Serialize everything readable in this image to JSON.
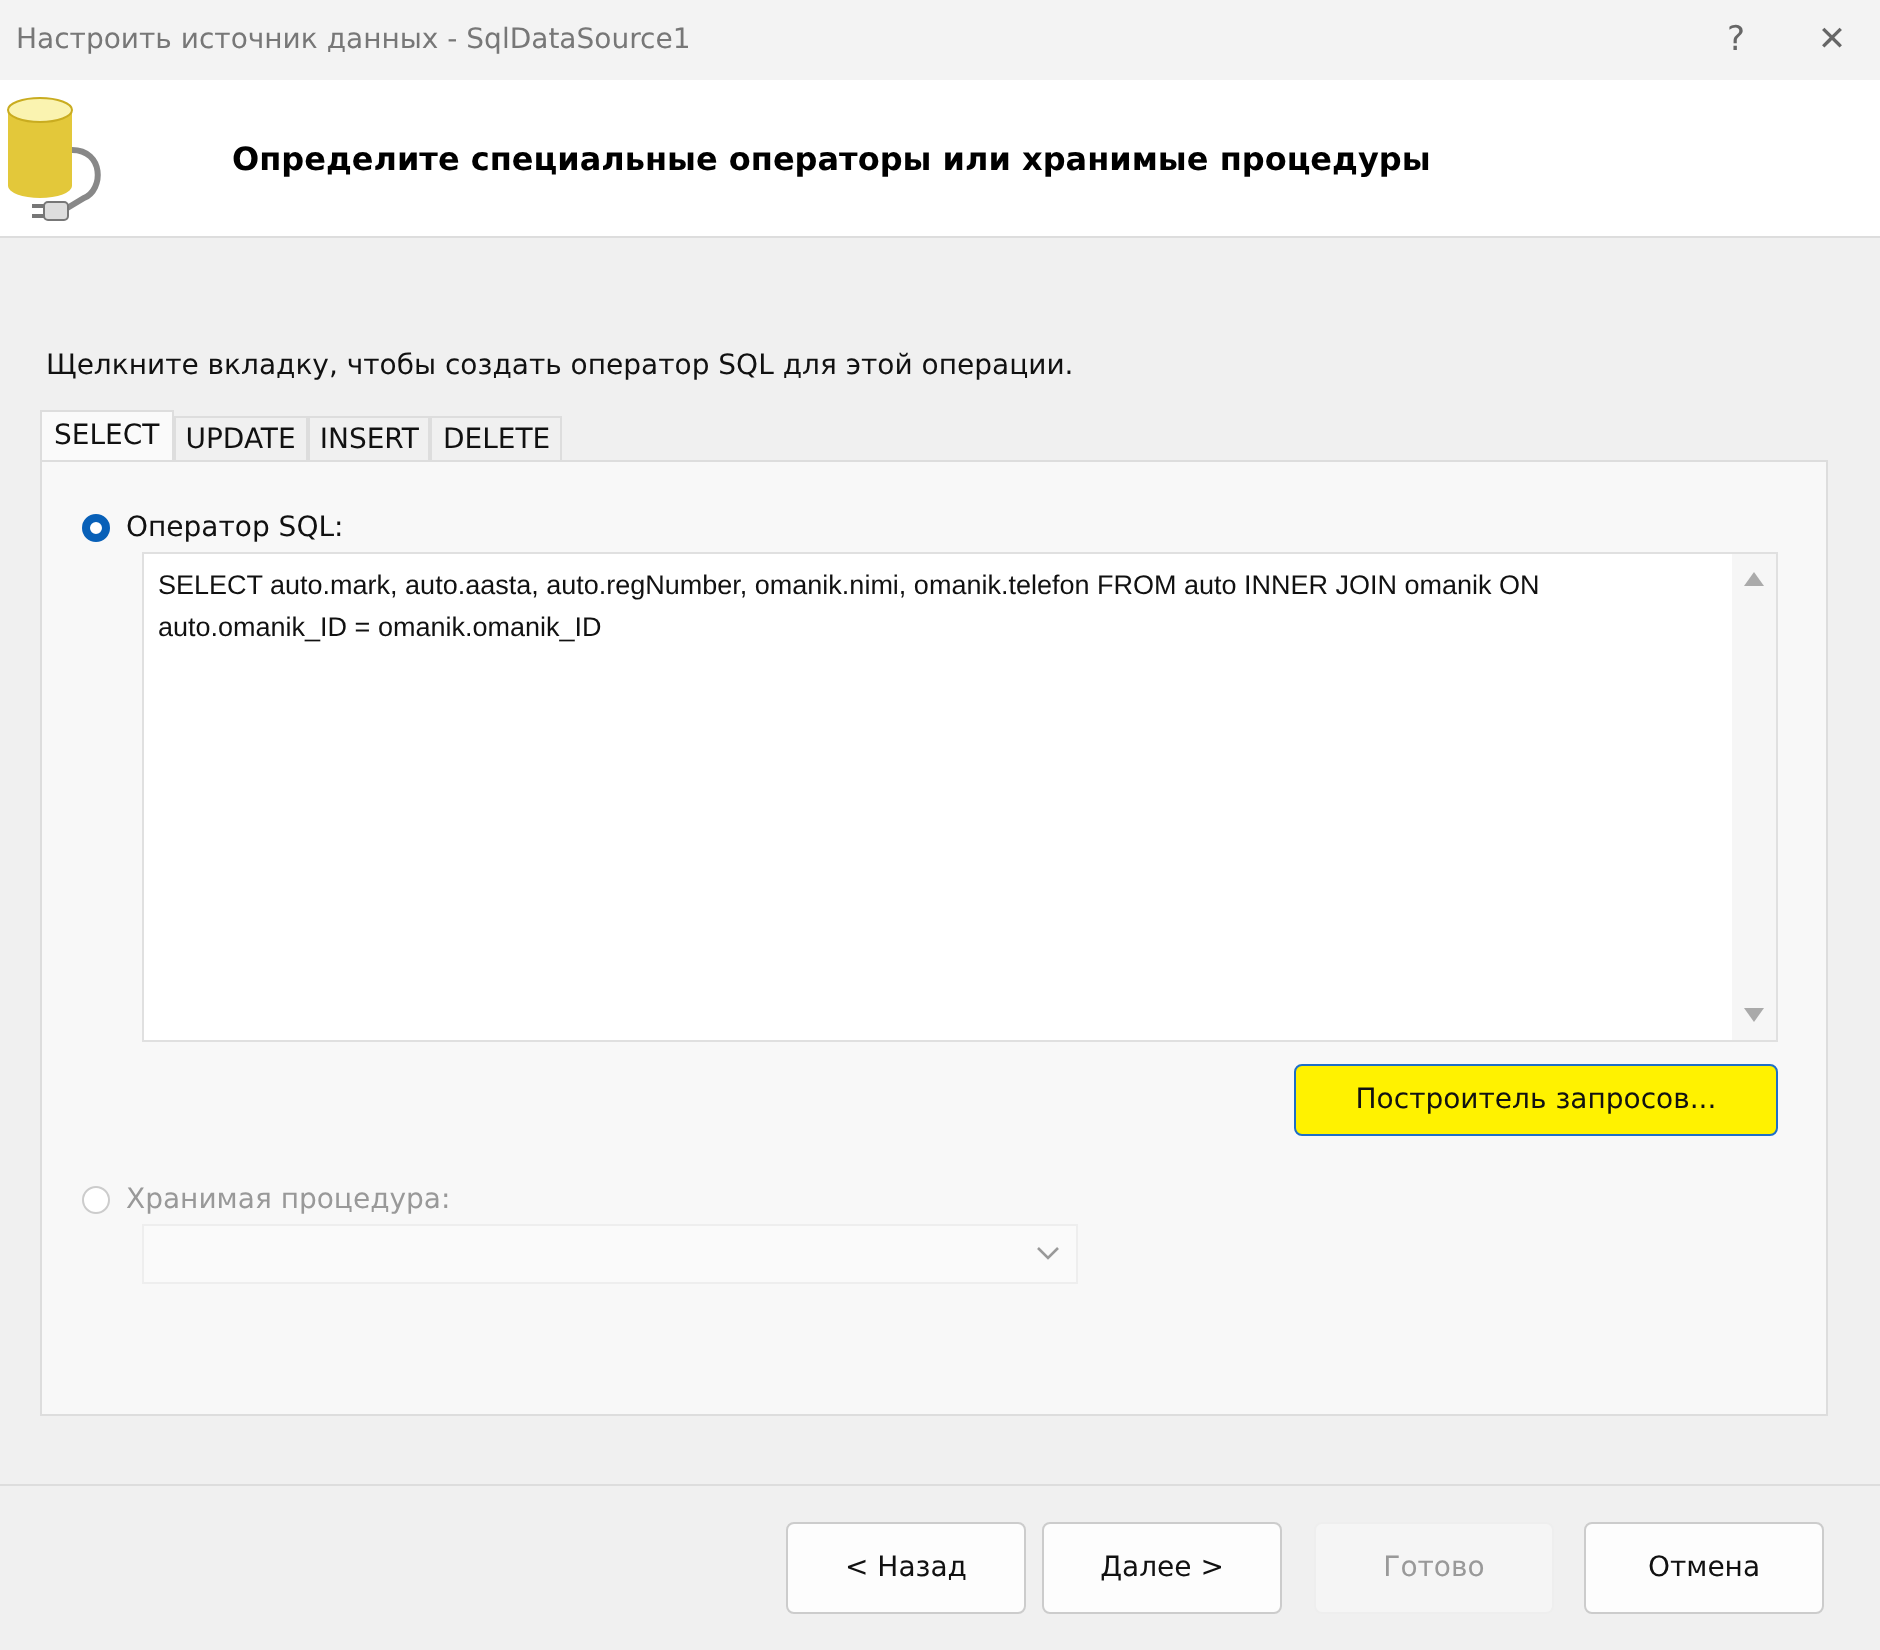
{
  "window": {
    "title": "Настроить источник данных - SqlDataSource1",
    "help": "?",
    "close": "✕"
  },
  "header": {
    "title": "Определите специальные операторы или хранимые процедуры"
  },
  "instruction": "Щелкните вкладку, чтобы создать оператор SQL для этой операции.",
  "tabs": [
    {
      "label": "SELECT",
      "selected": true
    },
    {
      "label": "UPDATE",
      "selected": false
    },
    {
      "label": "INSERT",
      "selected": false
    },
    {
      "label": "DELETE",
      "selected": false
    }
  ],
  "options": [
    {
      "label": "Оператор SQL:",
      "selected": true,
      "disabled": false
    },
    {
      "label": "Хранимая процедура:",
      "selected": false,
      "disabled": true
    }
  ],
  "sql_text": "SELECT auto.mark, auto.aasta, auto.regNumber, omanik.nimi, omanik.telefon FROM auto INNER JOIN omanik ON auto.omanik_ID = omanik.omanik_ID",
  "query_builder_button": {
    "label": "Построитель запросов...",
    "highlighted": true
  },
  "buttons": [
    {
      "label": "< Назад",
      "disabled": false
    },
    {
      "label": "Далее >",
      "disabled": false
    },
    {
      "label": "Готово",
      "disabled": true
    },
    {
      "label": "Отмена",
      "disabled": false
    }
  ]
}
